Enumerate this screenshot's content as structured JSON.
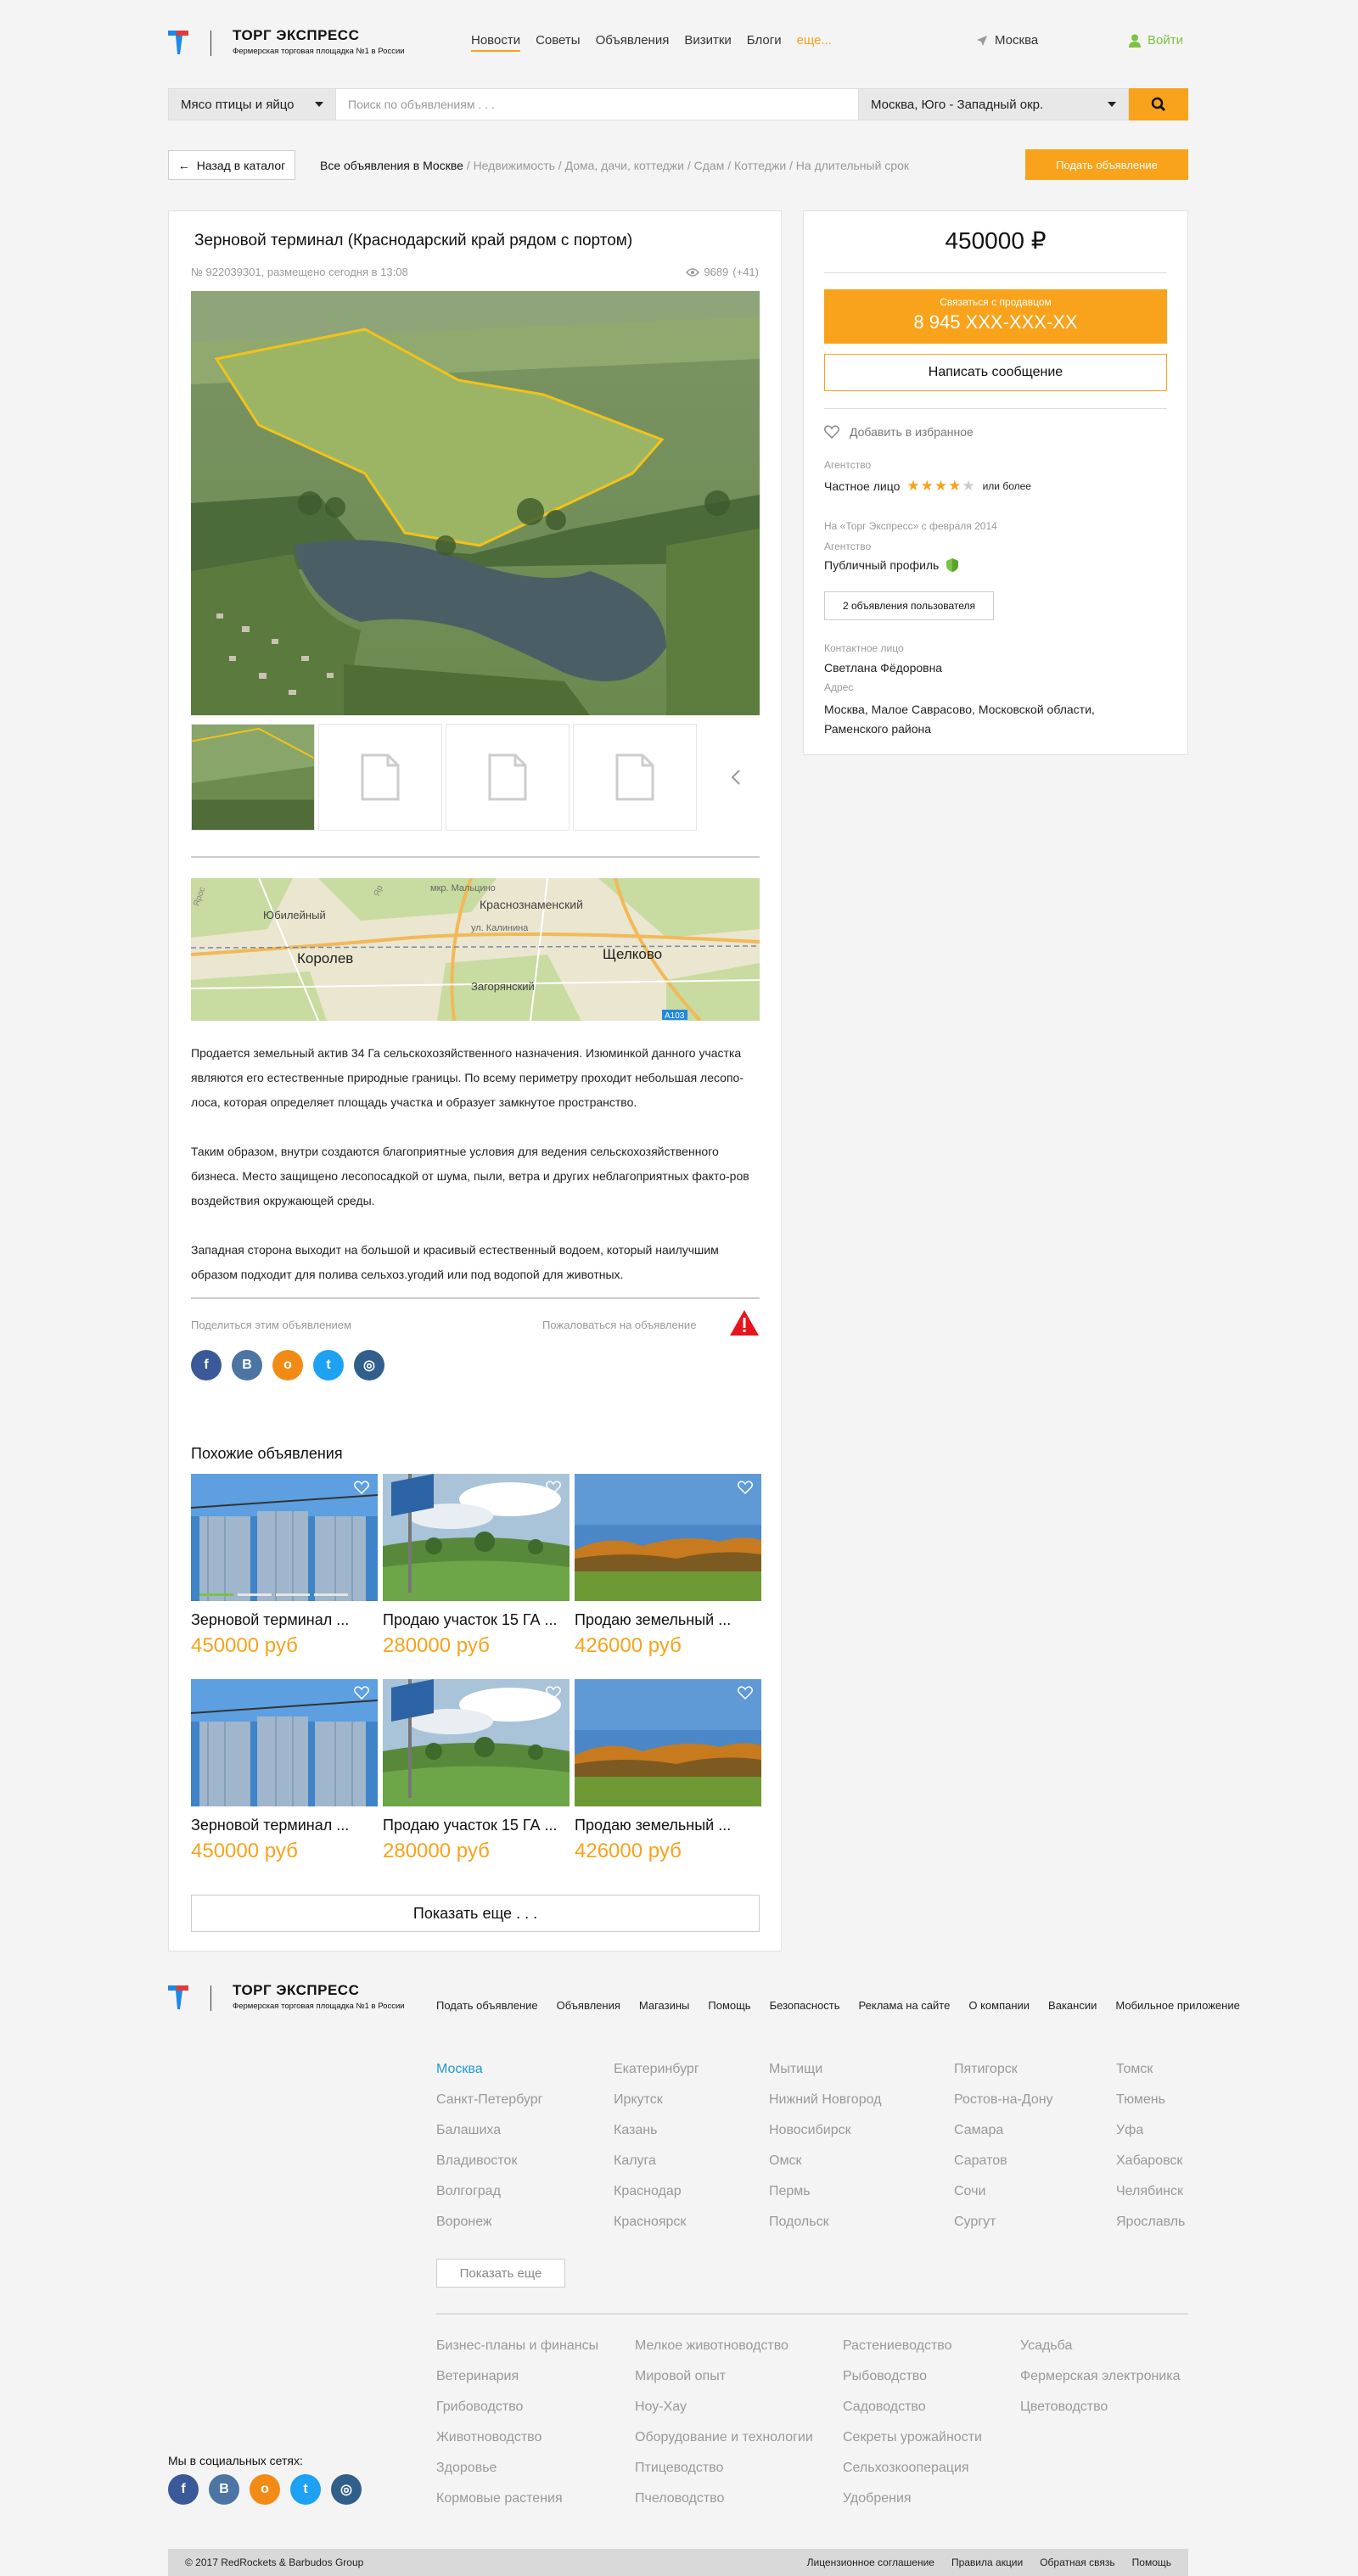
{
  "header": {
    "logo_title": "ТОРГ ЭКСПРЕСС",
    "logo_sub": "Фермерская торговая площадка №1 в России",
    "nav": [
      "Новости",
      "Советы",
      "Объявления",
      "Визитки",
      "Блоги",
      "еще..."
    ],
    "city": "Москва",
    "login": "Войти"
  },
  "search": {
    "category": "Мясо птицы и яйцо",
    "placeholder": "Поиск по объявлениям . . .",
    "region": "Москва, Юго - Западный окр."
  },
  "breadcrumb": {
    "back": "Назад в каталог",
    "root": "Все объявления в Москве",
    "path": " / Недвижимость / Дома, дачи, коттеджи / Сдам / Коттеджи / На длительный срок",
    "post_button": "Подать объявление"
  },
  "listing": {
    "title": "Зерновой терминал (Краснодарский край рядом с портом)",
    "meta": "№ 922039301, размещено сегодня в 13:08",
    "views": "9689",
    "views_delta": "(+41)",
    "map_labels": [
      "Юбилейный",
      "Краснознаменский",
      "Королев",
      "Щелково",
      "Загорянский",
      "мкр. Мальцино",
      "ул. Калинина",
      "Ярос",
      "Яр"
    ],
    "map_road": "A103",
    "description": [
      "Продается земельный актив 34 Га сельскохозяйственного назначения. Изюминкой данного участка являются его естественные природные границы. По всему периметру проходит небольшая лесопо-лоса, которая определяет площадь участка и образует замкнутое пространство.",
      "Таким образом, внутри создаются благоприятные условия для ведения сельскохозяйственного бизнеса. Место защищено лесопосадкой от шума, пыли, ветра и других неблагоприятных факто-ров воздействия окружающей среды.",
      "Западная сторона выходит на большой и красивый естественный водоем, который наилучшим образом подходит для полива сельхоз.угодий или под водопой для животных."
    ],
    "share": "Поделиться этим объявлением",
    "complain": "Пожаловаться на объявление"
  },
  "sidebar": {
    "price": "450000",
    "currency": "₽",
    "contact_label": "Связаться с продавцом",
    "phone": "8 945 XXX-XXX-XX",
    "message_btn": "Написать сообщение",
    "favorite": "Добавить в избранное",
    "agency_label": "Агентство",
    "seller_type": "Частное лицо",
    "rating_stars": 4,
    "rating_note": "или более",
    "since": "На «Торг Экспресс» с февраля 2014",
    "agency_label2": "Агентство",
    "profile": "Публичный профиль",
    "user_ads_btn": "2 объявления пользователя",
    "contact_person_label": "Контактное лицо",
    "contact_person": "Светлана Фёдоровна",
    "address_label": "Адрес",
    "address": "Москва, Малое Саврасово, Московской области, Раменского района"
  },
  "similar": {
    "heading": "Похожие объявления",
    "items": [
      {
        "title": "Зерновой терминал ...",
        "price": "450000 руб"
      },
      {
        "title": "Продаю участок 15 ГА ...",
        "price": "280000 руб"
      },
      {
        "title": "Продаю земельный ...",
        "price": "426000 руб"
      },
      {
        "title": "Зерновой терминал ...",
        "price": "450000 руб"
      },
      {
        "title": "Продаю участок 15 ГА ...",
        "price": "280000 руб"
      },
      {
        "title": "Продаю земельный ...",
        "price": "426000 руб"
      }
    ],
    "more_btn": "Показать еще . . ."
  },
  "footer": {
    "links": [
      "Подать объявление",
      "Объявления",
      "Магазины",
      "Помощь",
      "Безопасность",
      "Реклама на сайте",
      "О компании",
      "Вакансии",
      "Мобильное приложение"
    ],
    "cities": [
      [
        "Москва",
        "Санкт-Петербург",
        "Балашиха",
        "Владивосток",
        "Волгоград",
        "Воронеж"
      ],
      [
        "Екатеринбург",
        "Иркутск",
        "Казань",
        "Калуга",
        "Краснодар",
        "Красноярск"
      ],
      [
        "Мытищи",
        "Нижний Новгород",
        "Новосибирск",
        "Омск",
        "Пермь",
        "Подольск"
      ],
      [
        "Пятигорск",
        "Ростов-на-Дону",
        "Самара",
        "Саратов",
        "Сочи",
        "Сургут"
      ],
      [
        "Томск",
        "Тюмень",
        "Уфа",
        "Хабаровск",
        "Челябинск",
        "Ярославль"
      ]
    ],
    "show_more": "Показать еще",
    "categories": [
      [
        "Бизнес-планы и финансы",
        "Ветеринария",
        "Грибоводство",
        "Животноводство",
        "Здоровье",
        "Кормовые растения"
      ],
      [
        "Мелкое животноводство",
        "Мировой опыт",
        "Ноу-Хау",
        "Оборудование и технологии",
        "Птицеводство",
        "Пчеловодство"
      ],
      [
        "Растениеводство",
        "Рыбоводство",
        "Садоводство",
        "Секреты урожайности",
        "Сельхозкооперация",
        "Удобрения"
      ],
      [
        "Усадьба",
        "Фермерская электроника",
        "Цветоводство"
      ]
    ],
    "social_label": "Мы в социальных сетях:",
    "copyright": "© 2017 RedRockets & Barbudos Group",
    "bottom_links": [
      "Лицензионное соглашение",
      "Правила акции",
      "Обратная связь",
      "Помощь"
    ]
  },
  "colors": {
    "accent": "#f8a31b",
    "green": "#7cc242",
    "link_blue": "#1e9bd7"
  }
}
